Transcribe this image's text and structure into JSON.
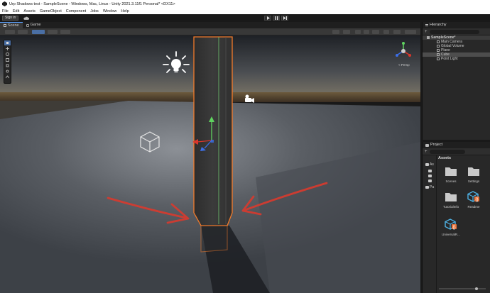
{
  "window": {
    "title": "Urp Shadows test - SampleScene - Windows, Mac, Linux - Unity 2021.3.11f1 Personal* <DX11>"
  },
  "menu": [
    "File",
    "Edit",
    "Assets",
    "GameObject",
    "Component",
    "Jobs",
    "Window",
    "Help"
  ],
  "toolbar": {
    "sign_in": "Sign in"
  },
  "tabs": {
    "scene": "Scene",
    "game": "Game"
  },
  "hierarchy": {
    "tab": "Hierarchy",
    "scene_name": "SampleScene*",
    "items": [
      "Main Camera",
      "Global Volume",
      "Plane",
      "Cube",
      "Point Light"
    ],
    "selected": "Cube"
  },
  "project": {
    "tab": "Project",
    "breadcrumb": "Assets",
    "tree": [
      "As",
      "Pa"
    ],
    "assets": [
      {
        "name": "Scenes",
        "kind": "folder"
      },
      {
        "name": "Settings",
        "kind": "folder"
      },
      {
        "name": "TutorialInfo",
        "kind": "folder"
      },
      {
        "name": "Readme",
        "kind": "script-asset"
      },
      {
        "name": "UniversalR...",
        "kind": "script-asset"
      }
    ]
  },
  "gizmo": {
    "persp_label": "< Persp"
  },
  "colors": {
    "selection_outline": "#f27a2a",
    "arrow_annotation": "#d93a2e",
    "accent": "#5aa0ff",
    "asset_icon": "#4fb3e6"
  },
  "icons": [
    "unity-icon",
    "cloud-icon",
    "play-icon",
    "pause-icon",
    "step-icon",
    "light-icon",
    "camera-icon",
    "volume-icon",
    "folder-icon"
  ]
}
